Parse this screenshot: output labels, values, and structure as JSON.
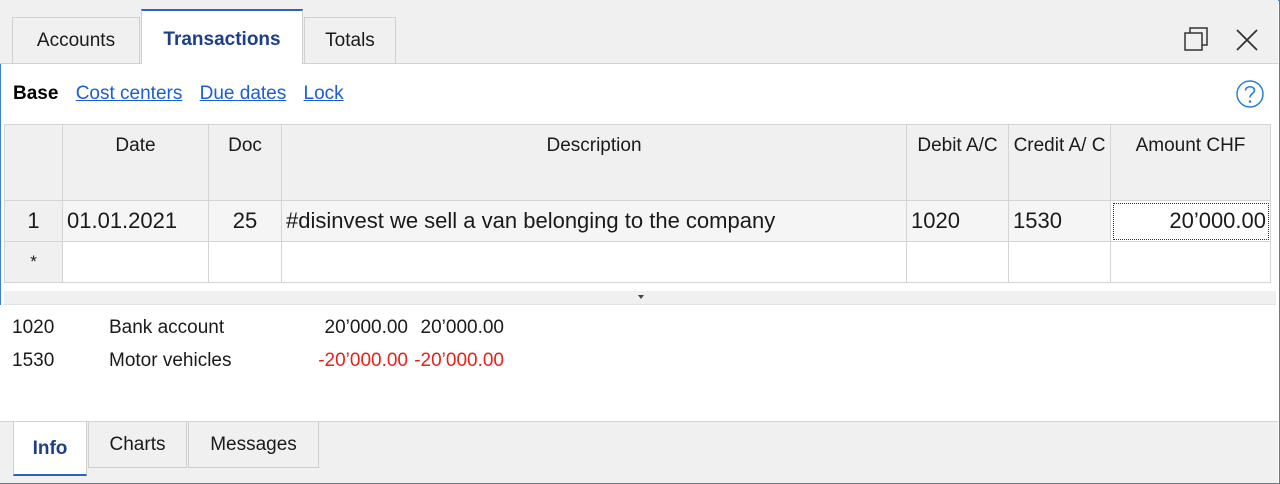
{
  "tabs": {
    "accounts": "Accounts",
    "transactions": "Transactions",
    "totals": "Totals"
  },
  "subnav": {
    "base": "Base",
    "cost_centers": "Cost centers",
    "due_dates": "Due dates",
    "lock": "Lock"
  },
  "table": {
    "columns": {
      "date": "Date",
      "doc": "Doc",
      "description": "Description",
      "debit": "Debit A/C",
      "credit": "Credit A/ C",
      "amount": "Amount CHF"
    },
    "rows": [
      {
        "num": "1",
        "date": "01.01.2021",
        "doc": "25",
        "description": "#disinvest we sell a van belonging to the company",
        "debit": "1020",
        "credit": "1530",
        "amount": "20’000.00"
      }
    ],
    "new_row_marker": "*"
  },
  "info": {
    "lines": [
      {
        "account": "1020",
        "name": "Bank account",
        "value1": "20’000.00",
        "value2": "20’000.00"
      },
      {
        "account": "1530",
        "name": "Motor vehicles",
        "value1": "-20’000.00",
        "value2": "-20’000.00"
      }
    ]
  },
  "bottom_tabs": {
    "info": "Info",
    "charts": "Charts",
    "messages": "Messages"
  },
  "icons": {
    "restore": "restore-window-icon",
    "close": "close-icon",
    "help": "help-icon"
  },
  "colors": {
    "accent": "#2d62c0",
    "link": "#1a5dd6",
    "negative": "#e8201a"
  }
}
